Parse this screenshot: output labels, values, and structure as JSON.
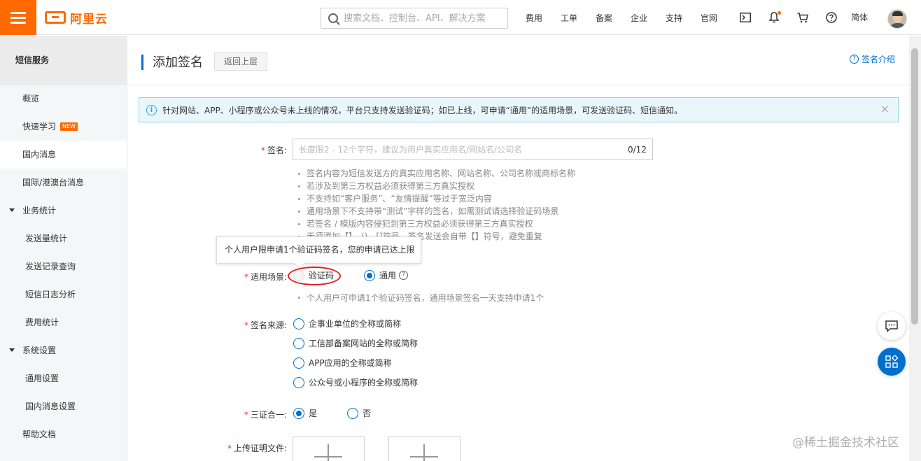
{
  "topbar": {
    "logo_text": "阿里云",
    "search_placeholder": "搜索文档、控制台、API、解决方案",
    "nav_links": [
      "费用",
      "工单",
      "备案",
      "企业",
      "支持",
      "官网"
    ],
    "language": "简体"
  },
  "sidebar": {
    "title": "短信服务",
    "items": [
      {
        "label": "概览"
      },
      {
        "label": "快速学习",
        "badge": "NEW"
      },
      {
        "label": "国内消息"
      },
      {
        "label": "国际/港澳台消息"
      },
      {
        "label": "业务统计"
      },
      {
        "label": "发送量统计"
      },
      {
        "label": "发送记录查询"
      },
      {
        "label": "短信日志分析"
      },
      {
        "label": "费用统计"
      },
      {
        "label": "系统设置"
      },
      {
        "label": "通用设置"
      },
      {
        "label": "国内消息设置"
      },
      {
        "label": "帮助文档"
      }
    ]
  },
  "header": {
    "title": "添加签名",
    "back_label": "返回上层",
    "help_label": "签名介绍"
  },
  "notice": {
    "text": "针对网站、APP、小程序或公众号未上线的情况，平台只支持发送验证码；如已上线，可申请“通用”的适用场景，可发送验证码、短信通知。",
    "close": "×"
  },
  "form": {
    "signature": {
      "label": "签名:",
      "placeholder": "长度限2 - 12个字符，建议为用户真实应用名/网站名/公司名",
      "counter": "0/12",
      "tips": [
        "签名内容为短信发送方的真实应用名称、网站名称、公司名称或商标名称",
        "若涉及到第三方权益必须获得第三方真实授权",
        "不支持如“客户服务”、“友情提醒”等过于宽泛内容",
        "通用场景下不支持带“测试”字样的签名，如需测试请选择验证码场景",
        "若签名 / 模版内容侵犯到第三方权益必须获得第三方真实授权",
        "无须添加【】、()、[]符号，签名发送会自带【】符号，避免重复"
      ]
    },
    "tooltip": "个人用户限申请1个验证码签名，您的申请已达上限",
    "scene": {
      "label": "适用场景:",
      "option_verify": "验证码",
      "option_general": "通用",
      "help_icon": "?",
      "hint": "个人用户可申请1个验证码签名，通用场景签名一天支持申请1个"
    },
    "source": {
      "label": "签名来源:",
      "options": [
        "企事业单位的全称或简称",
        "工信部备案网站的全称或简称",
        "APP应用的全称或简称",
        "公众号或小程序的全称或简称"
      ]
    },
    "three_in_one": {
      "label": "三证合一:",
      "yes": "是",
      "no": "否"
    },
    "upload": {
      "label": "上传证明文件:"
    }
  },
  "watermark": "@稀土掘金技术社区",
  "colors": {
    "accent": "#ff6a00",
    "primary": "#0070cc",
    "required": "#e5322d"
  }
}
